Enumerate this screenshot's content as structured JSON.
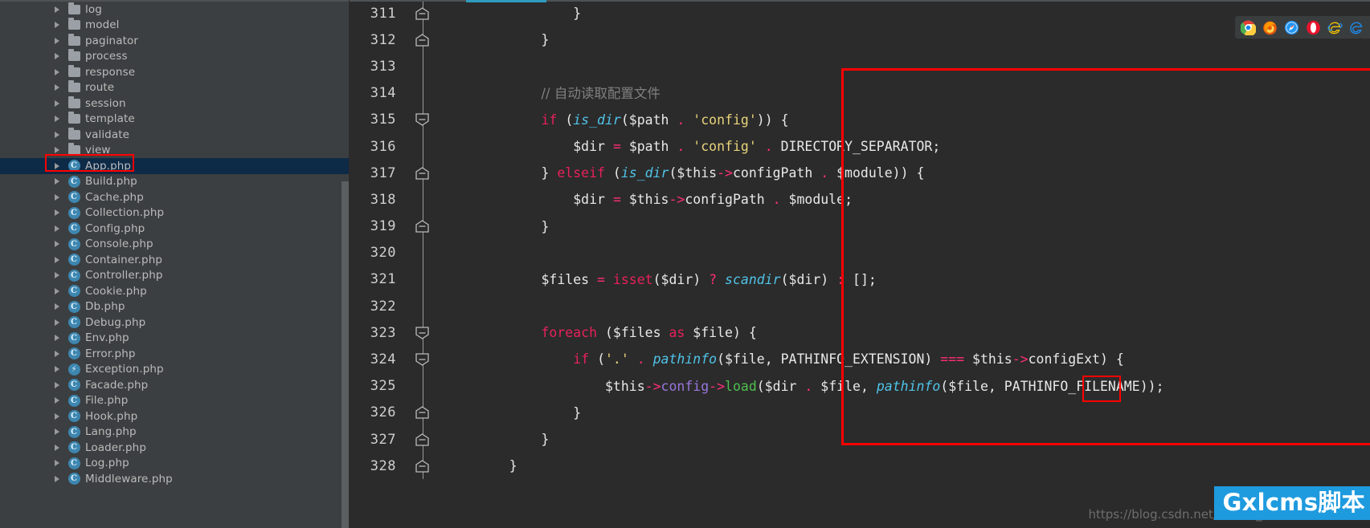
{
  "sidebar": {
    "tree_items": [
      {
        "label": "log",
        "icon": "folder-icon",
        "kind": "folder",
        "selected": false
      },
      {
        "label": "model",
        "icon": "folder-icon",
        "kind": "folder",
        "selected": false
      },
      {
        "label": "paginator",
        "icon": "folder-icon",
        "kind": "folder",
        "selected": false
      },
      {
        "label": "process",
        "icon": "folder-icon",
        "kind": "folder",
        "selected": false
      },
      {
        "label": "response",
        "icon": "folder-icon",
        "kind": "folder",
        "selected": false
      },
      {
        "label": "route",
        "icon": "folder-icon",
        "kind": "folder",
        "selected": false
      },
      {
        "label": "session",
        "icon": "folder-icon",
        "kind": "folder",
        "selected": false
      },
      {
        "label": "template",
        "icon": "folder-icon",
        "kind": "folder",
        "selected": false
      },
      {
        "label": "validate",
        "icon": "folder-icon",
        "kind": "folder",
        "selected": false
      },
      {
        "label": "view",
        "icon": "folder-icon",
        "kind": "folder",
        "selected": false
      },
      {
        "label": "App.php",
        "icon": "php-class-icon",
        "kind": "class",
        "selected": true
      },
      {
        "label": "Build.php",
        "icon": "php-class-icon",
        "kind": "class",
        "selected": false
      },
      {
        "label": "Cache.php",
        "icon": "php-class-icon",
        "kind": "class",
        "selected": false
      },
      {
        "label": "Collection.php",
        "icon": "php-class-icon",
        "kind": "class",
        "selected": false
      },
      {
        "label": "Config.php",
        "icon": "php-class-icon",
        "kind": "class",
        "selected": false
      },
      {
        "label": "Console.php",
        "icon": "php-class-icon",
        "kind": "class",
        "selected": false
      },
      {
        "label": "Container.php",
        "icon": "php-class-icon",
        "kind": "class",
        "selected": false
      },
      {
        "label": "Controller.php",
        "icon": "php-class-icon",
        "kind": "class",
        "selected": false
      },
      {
        "label": "Cookie.php",
        "icon": "php-class-icon",
        "kind": "class",
        "selected": false
      },
      {
        "label": "Db.php",
        "icon": "php-class-icon",
        "kind": "class",
        "selected": false
      },
      {
        "label": "Debug.php",
        "icon": "php-class-icon",
        "kind": "class",
        "selected": false
      },
      {
        "label": "Env.php",
        "icon": "php-class-icon",
        "kind": "class",
        "selected": false
      },
      {
        "label": "Error.php",
        "icon": "php-class-icon",
        "kind": "class",
        "selected": false
      },
      {
        "label": "Exception.php",
        "icon": "php-exception-icon",
        "kind": "exception",
        "selected": false
      },
      {
        "label": "Facade.php",
        "icon": "php-class-icon",
        "kind": "class",
        "selected": false
      },
      {
        "label": "File.php",
        "icon": "php-class-icon",
        "kind": "class",
        "selected": false
      },
      {
        "label": "Hook.php",
        "icon": "php-class-icon",
        "kind": "class",
        "selected": false
      },
      {
        "label": "Lang.php",
        "icon": "php-class-icon",
        "kind": "class",
        "selected": false
      },
      {
        "label": "Loader.php",
        "icon": "php-class-icon",
        "kind": "class",
        "selected": false
      },
      {
        "label": "Log.php",
        "icon": "php-class-icon",
        "kind": "class",
        "selected": false
      },
      {
        "label": "Middleware.php",
        "icon": "php-class-icon",
        "kind": "class",
        "selected": false
      }
    ]
  },
  "editor": {
    "line_numbers": [
      "311",
      "312",
      "313",
      "314",
      "315",
      "316",
      "317",
      "318",
      "319",
      "320",
      "321",
      "322",
      "323",
      "324",
      "325",
      "326",
      "327",
      "328"
    ],
    "fold_markers": [
      {
        "line": "311",
        "type": "close"
      },
      {
        "line": "312",
        "type": "close"
      },
      {
        "line": "313",
        "type": "none"
      },
      {
        "line": "314",
        "type": "none"
      },
      {
        "line": "315",
        "type": "open"
      },
      {
        "line": "316",
        "type": "none"
      },
      {
        "line": "317",
        "type": "close"
      },
      {
        "line": "318",
        "type": "none"
      },
      {
        "line": "319",
        "type": "close"
      },
      {
        "line": "320",
        "type": "none"
      },
      {
        "line": "321",
        "type": "none"
      },
      {
        "line": "322",
        "type": "none"
      },
      {
        "line": "323",
        "type": "open"
      },
      {
        "line": "324",
        "type": "open"
      },
      {
        "line": "325",
        "type": "none"
      },
      {
        "line": "326",
        "type": "close"
      },
      {
        "line": "327",
        "type": "close"
      },
      {
        "line": "328",
        "type": "close"
      }
    ],
    "code_lines": [
      "            }",
      "        }",
      "",
      "        // 自动读取配置文件",
      "        if (is_dir($path . 'config')) {",
      "            $dir = $path . 'config' . DIRECTORY_SEPARATOR;",
      "        } elseif (is_dir($this->configPath . $module)) {",
      "            $dir = $this->configPath . $module;",
      "        }",
      "",
      "        $files = isset($dir) ? scandir($dir) : [];",
      "",
      "        foreach ($files as $file) {",
      "            if ('.' . pathinfo($file, PATHINFO_EXTENSION) === $this->configExt) {",
      "                $this->config->load($dir . $file, pathinfo($file, PATHINFO_FILENAME));",
      "            }",
      "        }",
      "    }"
    ],
    "highlighted_method": "load",
    "comment_text": "// 自动读取配置文件",
    "colors": {
      "background": "#2b2b2b",
      "sidebar_background": "#3c3f41",
      "selection": "#0d2a47",
      "annotation_red": "#ff0000",
      "keyword": "#e8215b",
      "function": "#4fc3e8",
      "string": "#e8d37a",
      "comment": "#808080",
      "property": "#9876dd",
      "method_highlight": "#4fbf4f",
      "tab_accent": "#2f9bbf"
    }
  },
  "browser_strip": {
    "icons": [
      {
        "name": "chrome-icon",
        "title": "Chrome"
      },
      {
        "name": "firefox-icon",
        "title": "Firefox"
      },
      {
        "name": "safari-icon",
        "title": "Safari"
      },
      {
        "name": "opera-icon",
        "title": "Opera"
      },
      {
        "name": "ie-icon",
        "title": "Internet Explorer"
      },
      {
        "name": "edge-icon",
        "title": "Edge"
      }
    ]
  },
  "watermarks": {
    "url": "https://blog.csdn.net/weixin_xxxxx",
    "brand": "Gxlcms脚本"
  }
}
